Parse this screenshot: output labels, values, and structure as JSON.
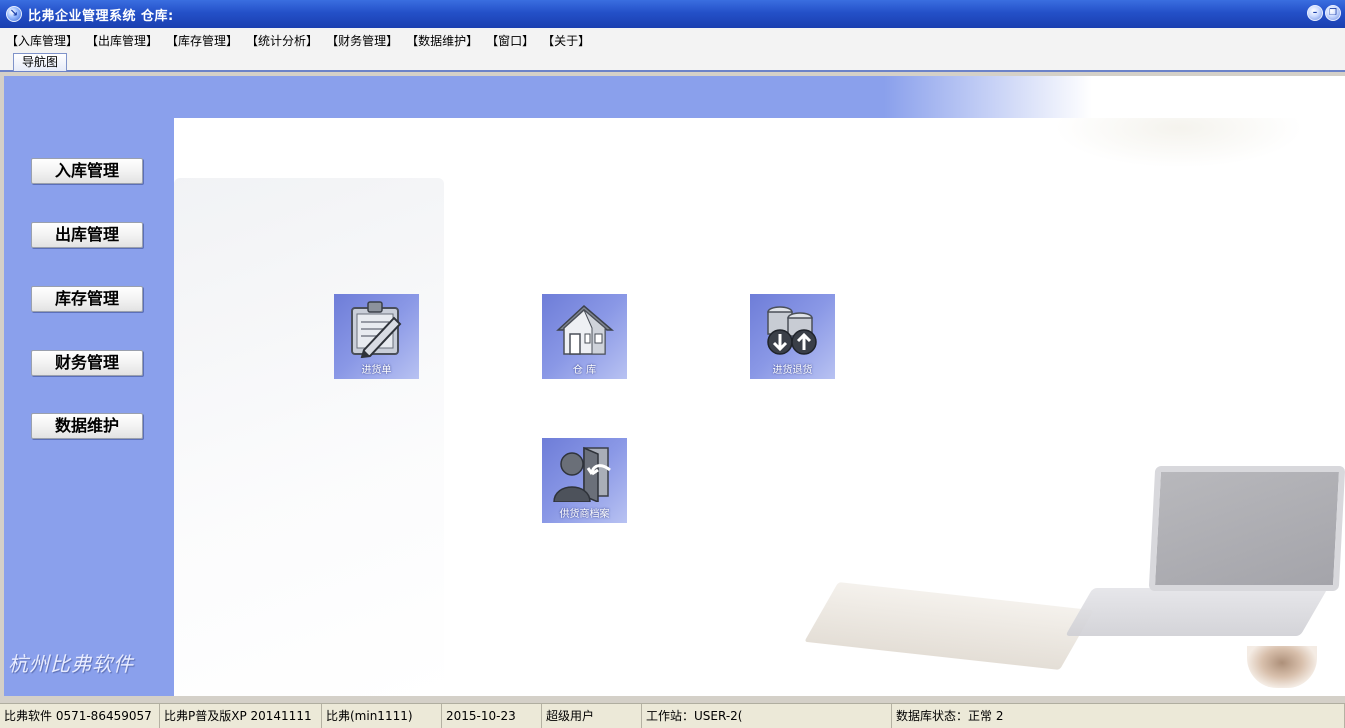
{
  "window": {
    "title": "比弗企业管理系统  仓库:",
    "minimize_glyph": "–",
    "restore_glyph": "❐"
  },
  "menu": [
    {
      "label": "【入库管理】"
    },
    {
      "label": "【出库管理】"
    },
    {
      "label": "【库存管理】"
    },
    {
      "label": "【统计分析】"
    },
    {
      "label": "【财务管理】"
    },
    {
      "label": "【数据维护】"
    },
    {
      "label": "【窗口】"
    },
    {
      "label": "【关于】"
    }
  ],
  "tabs": [
    {
      "label": "导航图",
      "active": true
    }
  ],
  "sidebar": {
    "buttons": [
      {
        "label": "入库管理"
      },
      {
        "label": "出库管理"
      },
      {
        "label": "库存管理"
      },
      {
        "label": "财务管理"
      },
      {
        "label": "数据维护"
      }
    ],
    "brand": "杭州比弗软件"
  },
  "tiles": [
    {
      "label": "进货单",
      "icon": "clipboard-pen-icon"
    },
    {
      "label": "仓  库",
      "icon": "house-icon"
    },
    {
      "label": "进货退货",
      "icon": "coins-exchange-icon"
    },
    {
      "label": "供货商档案",
      "icon": "supplier-person-icon"
    }
  ],
  "statusbar": [
    {
      "text": "比弗软件 0571-86459057"
    },
    {
      "text": "比弗P普及版XP   20141111"
    },
    {
      "text": "比弗(min1111)"
    },
    {
      "text": "2015-10-23"
    },
    {
      "text": "超级用户"
    },
    {
      "text": "工作站：USER-2("
    },
    {
      "text": "数据库状态：正常 2"
    }
  ],
  "colors": {
    "titlebar": "#2450c8",
    "sidebar": "#8aa0ec",
    "tile": "#7d8ce0",
    "statusbar": "#ece9d8"
  }
}
